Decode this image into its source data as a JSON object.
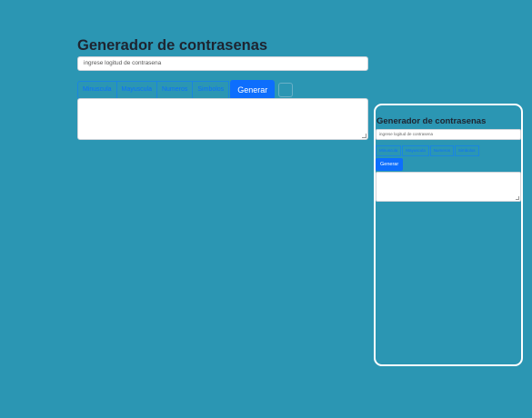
{
  "main": {
    "title": "Generador de contrasenas",
    "length_placeholder": "ingrese logitud de contrasena",
    "options": [
      "Minuscula",
      "Mayuscula",
      "Numeros",
      "Simbolos"
    ],
    "generate_label": "Generar"
  },
  "preview": {
    "title": "Generador de contrasenas",
    "length_placeholder": "ingrese logitud de contrasena",
    "options": [
      "Minuscula",
      "Mayuscula",
      "Numeros",
      "Simbolos"
    ],
    "generate_label": "Generar"
  },
  "colors": {
    "background": "#2b96b3",
    "accent": "#0d6efd",
    "frame": "#ffffff"
  }
}
